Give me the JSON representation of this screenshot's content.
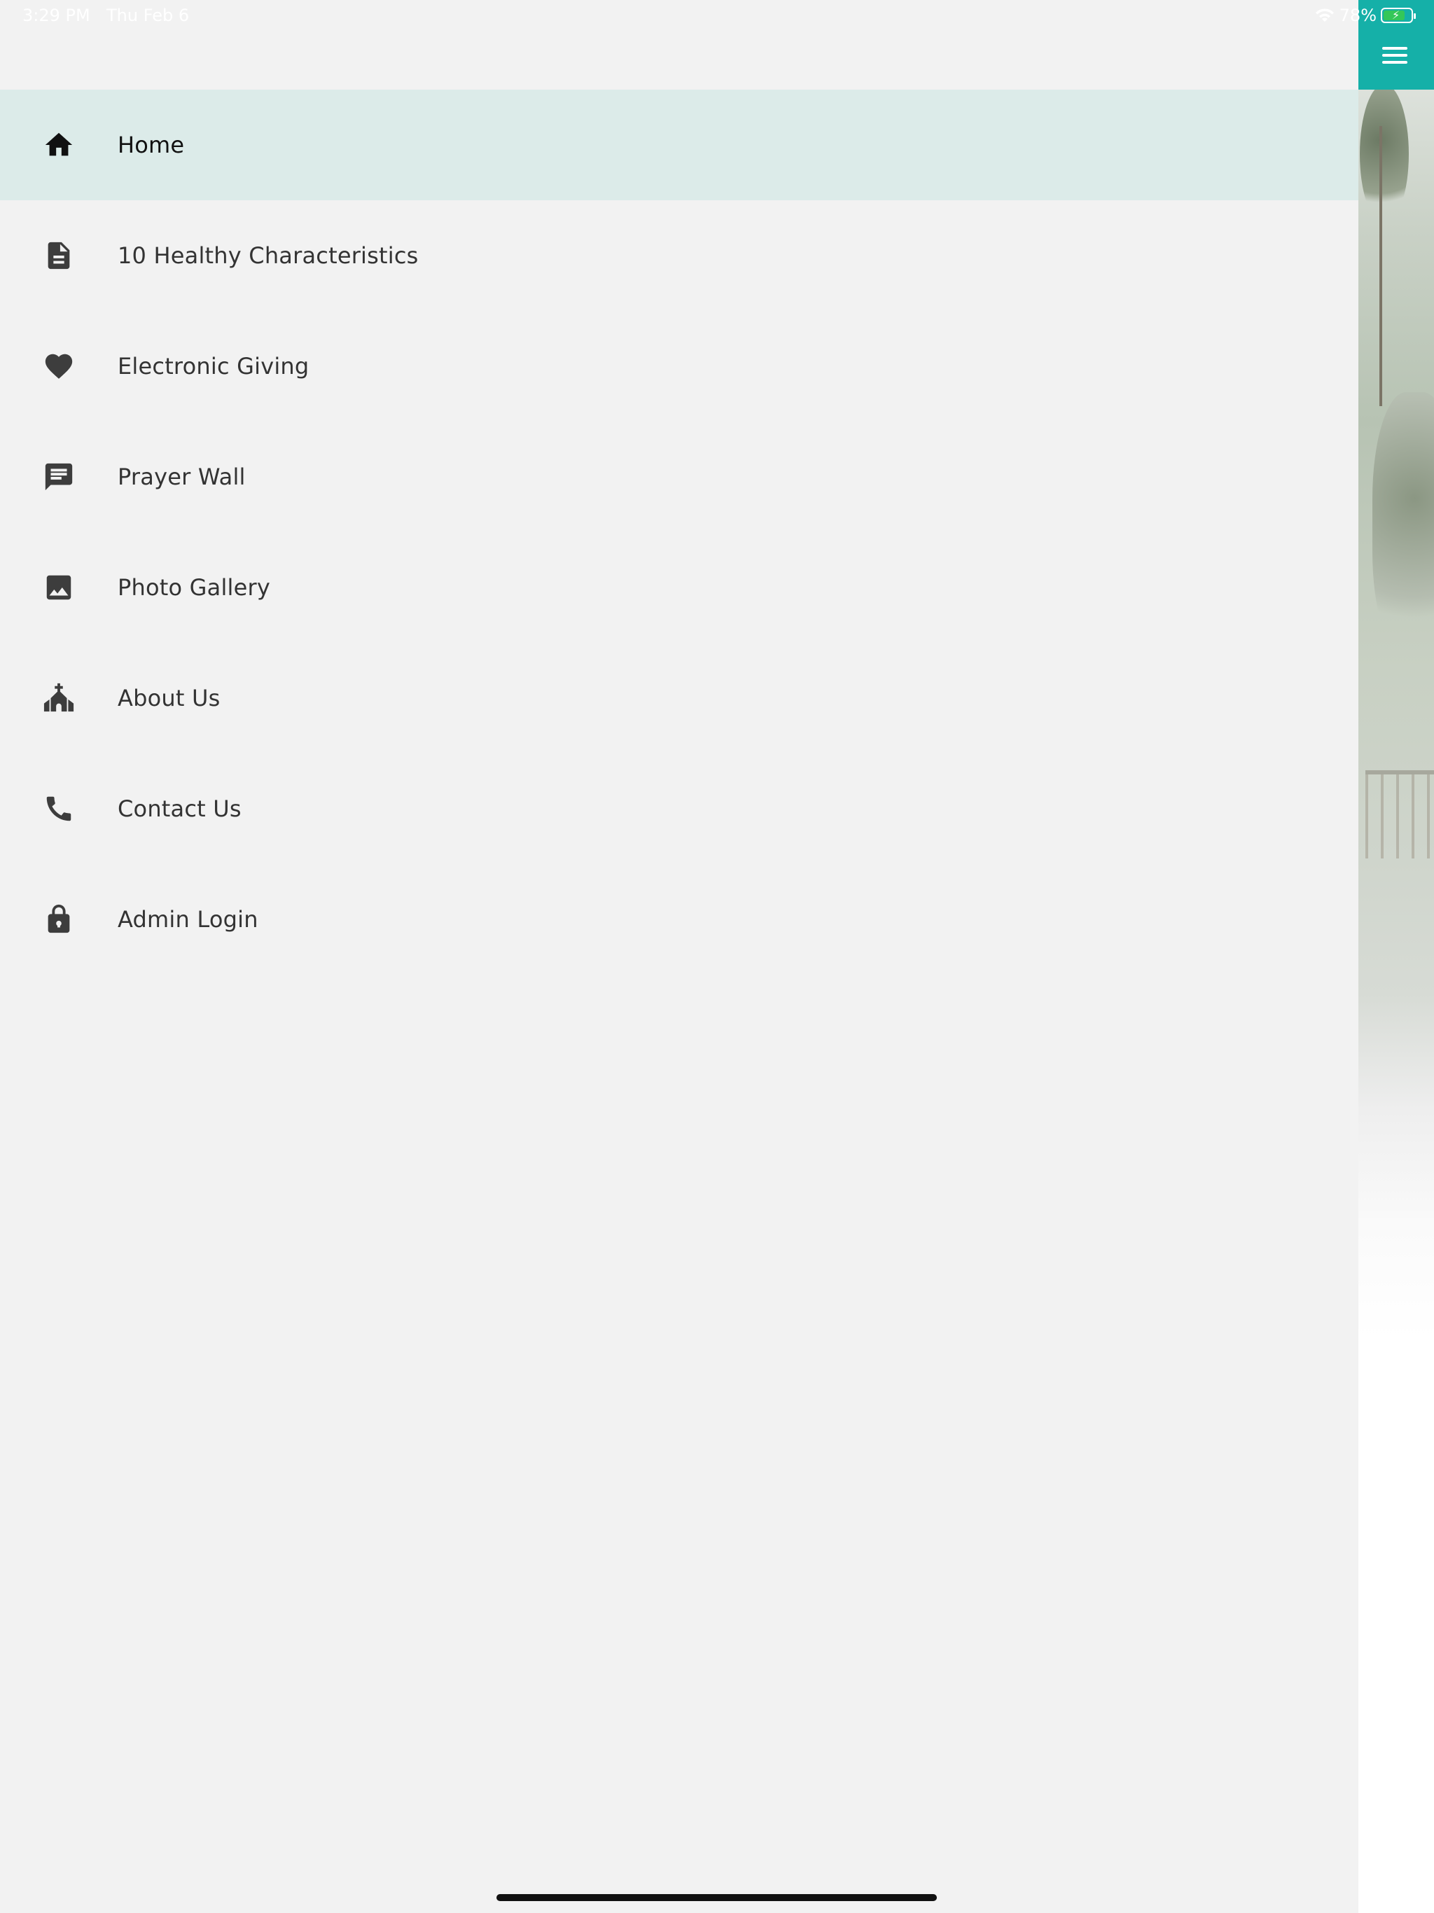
{
  "status_bar": {
    "time": "3:29 PM",
    "date": "Thu Feb 6",
    "battery": "78%",
    "battery_level": 0.78
  },
  "header": {
    "menu_icon": "hamburger-menu-icon",
    "accent_color": "#15b0a8"
  },
  "drawer": {
    "items": [
      {
        "label": "Home",
        "icon": "home-icon",
        "active": true
      },
      {
        "label": "10 Healthy Characteristics",
        "icon": "document-icon",
        "active": false
      },
      {
        "label": "Electronic Giving",
        "icon": "heart-icon",
        "active": false
      },
      {
        "label": "Prayer Wall",
        "icon": "message-icon",
        "active": false
      },
      {
        "label": "Photo Gallery",
        "icon": "image-icon",
        "active": false
      },
      {
        "label": "About Us",
        "icon": "church-icon",
        "active": false
      },
      {
        "label": "Contact Us",
        "icon": "phone-icon",
        "active": false
      },
      {
        "label": "Admin Login",
        "icon": "lock-icon",
        "active": false
      }
    ],
    "active_color": "#dcebe9"
  }
}
